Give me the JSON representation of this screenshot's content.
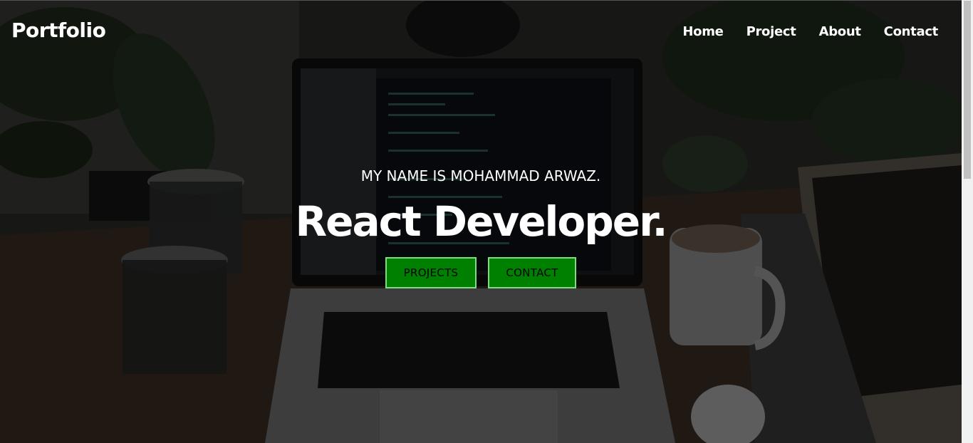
{
  "navbar": {
    "logo": "Portfolio",
    "links": [
      {
        "label": "Home"
      },
      {
        "label": "Project"
      },
      {
        "label": "About"
      },
      {
        "label": "Contact"
      }
    ]
  },
  "hero": {
    "intro": "MY NAME IS MOHAMMAD ARWAZ.",
    "title": "React Developer.",
    "buttons": {
      "projects_label": "PROJECTS",
      "contact_label": "CONTACT"
    }
  },
  "colors": {
    "button_bg": "#008000",
    "button_border": "#7fdc7f",
    "text": "#ffffff"
  }
}
